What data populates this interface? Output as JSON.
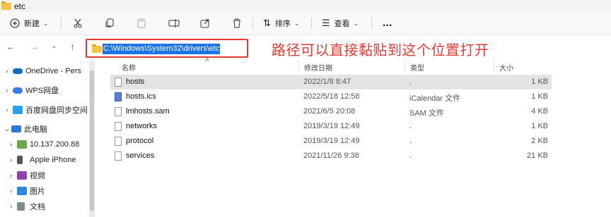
{
  "window": {
    "title": "etc"
  },
  "toolbar": {
    "new_label": "新建",
    "sort_label": "排序",
    "view_label": "查看",
    "more_label": "..."
  },
  "address": {
    "path": "C:\\Windows\\System32\\drivers\\etc",
    "annotation": "路径可以直接黏贴到这个位置打开"
  },
  "sidebar": {
    "items": [
      {
        "label": "OneDrive - Pers",
        "icon": "onedrive-icon"
      },
      {
        "label": "WPS网盘",
        "icon": "cloud-icon"
      },
      {
        "label": "百度网盘同步空间",
        "icon": "baidu-cloud-icon"
      },
      {
        "label": "此电脑",
        "icon": "computer-icon"
      },
      {
        "label": "10.137.200.88",
        "icon": "network-drive-icon"
      },
      {
        "label": "Apple iPhone",
        "icon": "phone-icon"
      },
      {
        "label": "视频",
        "icon": "video-icon"
      },
      {
        "label": "图片",
        "icon": "picture-icon"
      },
      {
        "label": "文档",
        "icon": "document-icon"
      }
    ]
  },
  "columns": {
    "name": "名称",
    "date": "修改日期",
    "type": "类型",
    "size": "大小"
  },
  "files": [
    {
      "name": "hosts",
      "date": "2022/1/8 8:47",
      "type": ".",
      "size": "1 KB"
    },
    {
      "name": "hosts.ics",
      "date": "2022/5/18 12:58",
      "type": "iCalendar 文件",
      "size": "1 KB"
    },
    {
      "name": "lmhosts.sam",
      "date": "2021/6/5 20:08",
      "type": "SAM 文件",
      "size": "4 KB"
    },
    {
      "name": "networks",
      "date": "2019/3/19 12:49",
      "type": ".",
      "size": "1 KB"
    },
    {
      "name": "protocol",
      "date": "2019/3/19 12:49",
      "type": ".",
      "size": "2 KB"
    },
    {
      "name": "services",
      "date": "2021/11/26 9:38",
      "type": ".",
      "size": "21 KB"
    }
  ]
}
